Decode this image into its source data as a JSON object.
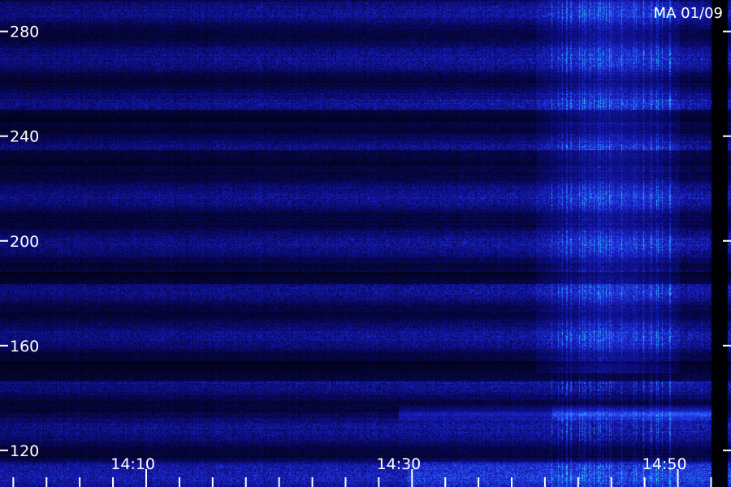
{
  "chart_data": {
    "type": "heatmap",
    "title": "MA 01/09",
    "x_ticks": [
      "14:10",
      "14:30",
      "14:50"
    ],
    "x_tick_values_min": [
      10,
      30,
      50
    ],
    "x_range_min": [
      0,
      55
    ],
    "y_ticks": [
      120,
      160,
      200,
      240,
      280
    ],
    "y_range": [
      106,
      292
    ],
    "grid": false,
    "colormap": [
      "#000000",
      "#0a0a70",
      "#1a22c8",
      "#2a5cff",
      "#25b4ff",
      "#35ffd2"
    ],
    "features": {
      "dark_gap_start_min": 53.5,
      "dark_gap_end_min": 54.0,
      "bright_emission_start_min": 41.5,
      "bright_emission_end_min": 50.5,
      "hot_band_value": 134
    }
  },
  "labels": {
    "station": "MA 01/09"
  }
}
